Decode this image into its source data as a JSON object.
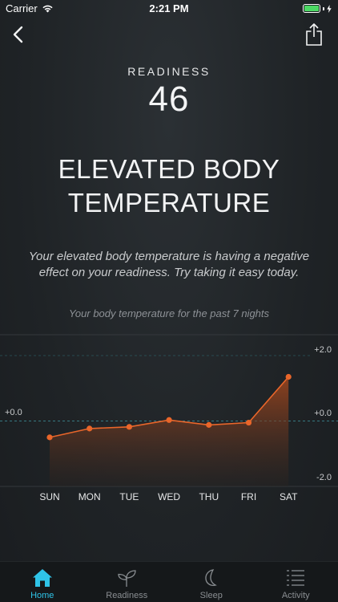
{
  "status_bar": {
    "carrier": "Carrier",
    "time": "2:21 PM"
  },
  "icons": {
    "back": "chevron-left-icon",
    "share": "share-icon"
  },
  "score": {
    "label": "READINESS",
    "value": "46"
  },
  "headline": "ELEVATED BODY TEMPERATURE",
  "description": "Your elevated body temperature is having a negative effect on your readiness. Try taking it easy today.",
  "chart_caption": "Your body temperature for the past 7 nights",
  "chart_data": {
    "type": "area",
    "categories": [
      "SUN",
      "MON",
      "TUE",
      "WED",
      "THU",
      "FRI",
      "SAT"
    ],
    "values": [
      -0.5,
      -0.23,
      -0.18,
      0.03,
      -0.12,
      -0.05,
      1.35
    ],
    "ylim": [
      -2.0,
      2.0
    ],
    "y_ticks_right": [
      "+2.0",
      "+0.0",
      "-2.0"
    ],
    "y_tick_left": "+0.0",
    "baseline": 0,
    "colors": {
      "line": "#e9662a",
      "fill_top": "#b34c1d",
      "fill_bottom": "#2a2320",
      "baseline": "#3d8f9a"
    }
  },
  "tabs": [
    {
      "label": "Home",
      "icon": "home-icon",
      "active": true
    },
    {
      "label": "Readiness",
      "icon": "sprout-icon",
      "active": false
    },
    {
      "label": "Sleep",
      "icon": "moon-icon",
      "active": false
    },
    {
      "label": "Activity",
      "icon": "activity-list-icon",
      "active": false
    }
  ],
  "colors": {
    "accent": "#2fc4e8",
    "background": "#1f2326"
  }
}
